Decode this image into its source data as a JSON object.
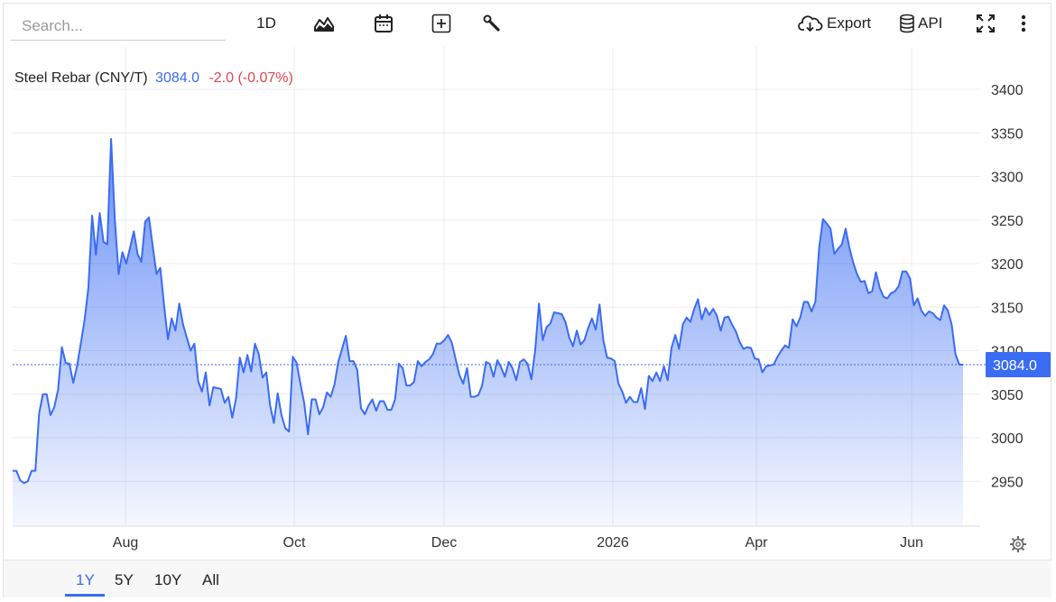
{
  "search": {
    "placeholder": "Search..."
  },
  "toolbar": {
    "interval_label": "1D",
    "export_label": "Export",
    "api_label": "API",
    "icons": [
      "area-chart-icon",
      "calendar-icon",
      "add-compare-icon",
      "wrench-icon",
      "cloud-download-icon",
      "database-icon",
      "fullscreen-icon",
      "more-vertical-icon"
    ]
  },
  "legend": {
    "name": "Steel Rebar (CNY/T)",
    "price": "3084.0",
    "change": "-2.0 (-0.07%)"
  },
  "last_price_label": "3084.0",
  "range_buttons": [
    "1Y",
    "5Y",
    "10Y",
    "All"
  ],
  "active_range": "1Y",
  "colors": {
    "line": "#3a6cf4",
    "negative": "#e0454d",
    "grid": "#ececec"
  },
  "chart_data": {
    "type": "area",
    "title": "Steel Rebar (CNY/T)",
    "x_ticks": [
      "Aug",
      "Oct",
      "Dec",
      "2026",
      "Apr",
      "Jun"
    ],
    "y_ticks": [
      2950,
      3000,
      3050,
      3100,
      3150,
      3200,
      3250,
      3300,
      3350,
      3400
    ],
    "ylim": [
      2905,
      3450
    ],
    "grid": true,
    "last_value": 3084.0,
    "series": [
      {
        "values": [
          2962,
          2962,
          2951,
          2948,
          2950,
          2962,
          2962,
          3028,
          3050,
          3050,
          3026,
          3035,
          3055,
          3104,
          3086,
          3085,
          3063,
          3082,
          3108,
          3135,
          3172,
          3255,
          3210,
          3258,
          3225,
          3222,
          3343,
          3250,
          3188,
          3213,
          3200,
          3218,
          3237,
          3211,
          3202,
          3248,
          3253,
          3220,
          3188,
          3195,
          3152,
          3113,
          3137,
          3123,
          3154,
          3130,
          3115,
          3100,
          3108,
          3065,
          3053,
          3075,
          3037,
          3058,
          3057,
          3056,
          3040,
          3047,
          3023,
          3045,
          3092,
          3075,
          3095,
          3076,
          3108,
          3096,
          3069,
          3075,
          3037,
          3017,
          3051,
          3026,
          3011,
          3007,
          3093,
          3086,
          3062,
          3040,
          3004,
          3044,
          3044,
          3027,
          3035,
          3052,
          3047,
          3061,
          3087,
          3102,
          3117,
          3088,
          3088,
          3078,
          3034,
          3027,
          3037,
          3044,
          3031,
          3042,
          3042,
          3032,
          3032,
          3044,
          3085,
          3080,
          3060,
          3060,
          3064,
          3088,
          3082,
          3087,
          3090,
          3096,
          3108,
          3108,
          3112,
          3118,
          3109,
          3090,
          3072,
          3062,
          3080,
          3047,
          3047,
          3049,
          3060,
          3087,
          3085,
          3070,
          3089,
          3081,
          3070,
          3087,
          3080,
          3066,
          3087,
          3090,
          3085,
          3067,
          3100,
          3154,
          3112,
          3127,
          3131,
          3144,
          3143,
          3142,
          3133,
          3115,
          3105,
          3123,
          3107,
          3112,
          3126,
          3137,
          3124,
          3153,
          3112,
          3092,
          3091,
          3088,
          3062,
          3053,
          3040,
          3047,
          3041,
          3041,
          3057,
          3033,
          3071,
          3065,
          3075,
          3065,
          3082,
          3066,
          3103,
          3118,
          3102,
          3130,
          3138,
          3133,
          3148,
          3159,
          3136,
          3149,
          3141,
          3148,
          3140,
          3123,
          3138,
          3139,
          3130,
          3122,
          3110,
          3102,
          3104,
          3103,
          3091,
          3090,
          3075,
          3082,
          3083,
          3084,
          3093,
          3100,
          3106,
          3103,
          3136,
          3128,
          3138,
          3156,
          3156,
          3145,
          3156,
          3218,
          3251,
          3246,
          3240,
          3211,
          3217,
          3222,
          3240,
          3218,
          3201,
          3188,
          3179,
          3180,
          3166,
          3168,
          3190,
          3172,
          3162,
          3160,
          3166,
          3168,
          3174,
          3191,
          3191,
          3183,
          3152,
          3160,
          3146,
          3140,
          3145,
          3143,
          3138,
          3135,
          3152,
          3146,
          3130,
          3096,
          3084,
          3084
        ]
      }
    ]
  }
}
